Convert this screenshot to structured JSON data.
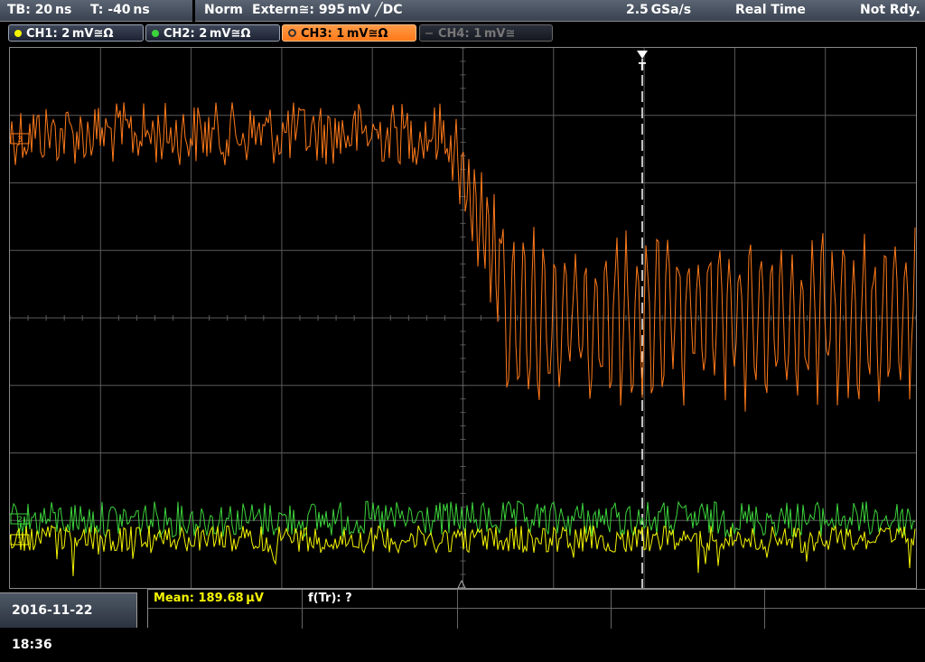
{
  "status": {
    "timebase": "TB: 20 ns",
    "trigger_time": "T: -40 ns",
    "mode": "Norm",
    "trigger_source": "Extern≅: 995 mV ╱DC",
    "sample_rate": "2.5 GSa/s",
    "acq_mode": "Real Time",
    "ready_state": "Not Rdy."
  },
  "channels": [
    {
      "label": "CH1: 2 mV≅Ω",
      "color": "#f4f400",
      "state": "on"
    },
    {
      "label": "CH2: 2 mV≅Ω",
      "color": "#3cd43c",
      "state": "on"
    },
    {
      "label": "CH3: 1 mV≅Ω",
      "color": "#ff7a1a",
      "state": "active"
    },
    {
      "label": "CH4: 1 mV≅",
      "color": "#666666",
      "state": "off"
    }
  ],
  "markers": {
    "trigger": "T",
    "ch1": "1",
    "ch2": "2",
    "ch3": "3"
  },
  "measurements": {
    "mean": "Mean: 189.68 μV",
    "rise": "f(Tr): ?"
  },
  "footer": {
    "datetime": "2016-11-22 18:36"
  },
  "colors": {
    "ch1": "#f4f400",
    "ch2": "#3cd43c",
    "ch3": "#ff7a1a",
    "grid": "#5a5a5a"
  }
}
